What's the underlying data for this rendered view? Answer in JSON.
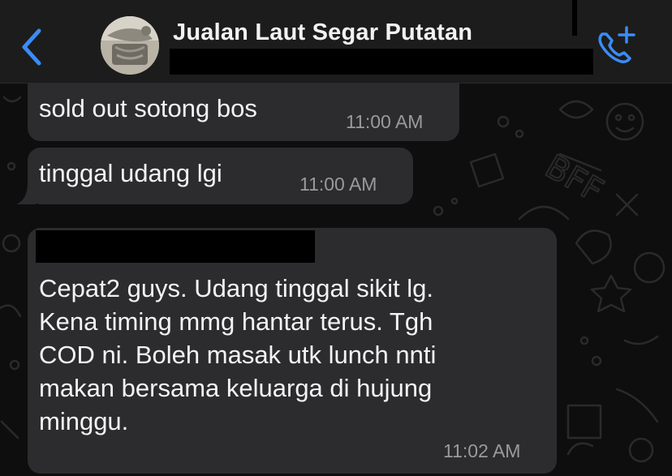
{
  "header": {
    "back_icon": "chevron-left-icon",
    "title": "Jualan Laut Segar Putatan",
    "call_icon": "phone-add-icon",
    "accent_color": "#3a8cf5"
  },
  "messages": [
    {
      "text": "sold out sotong bos",
      "time": "11:00 AM"
    },
    {
      "text": "tinggal udang lgi",
      "time": "11:00 AM"
    },
    {
      "text": "Cepat2 guys. Udang tinggal sikit lg.\nKena timing mmg hantar terus. Tgh\nCOD ni. Boleh masak utk lunch nnti\nmakan bersama keluarga di hujung\nminggu.",
      "time": "11:02 AM"
    }
  ],
  "colors": {
    "bubble": "#2c2c2e",
    "header": "#1c1c1d",
    "background": "#0e0e0f"
  }
}
